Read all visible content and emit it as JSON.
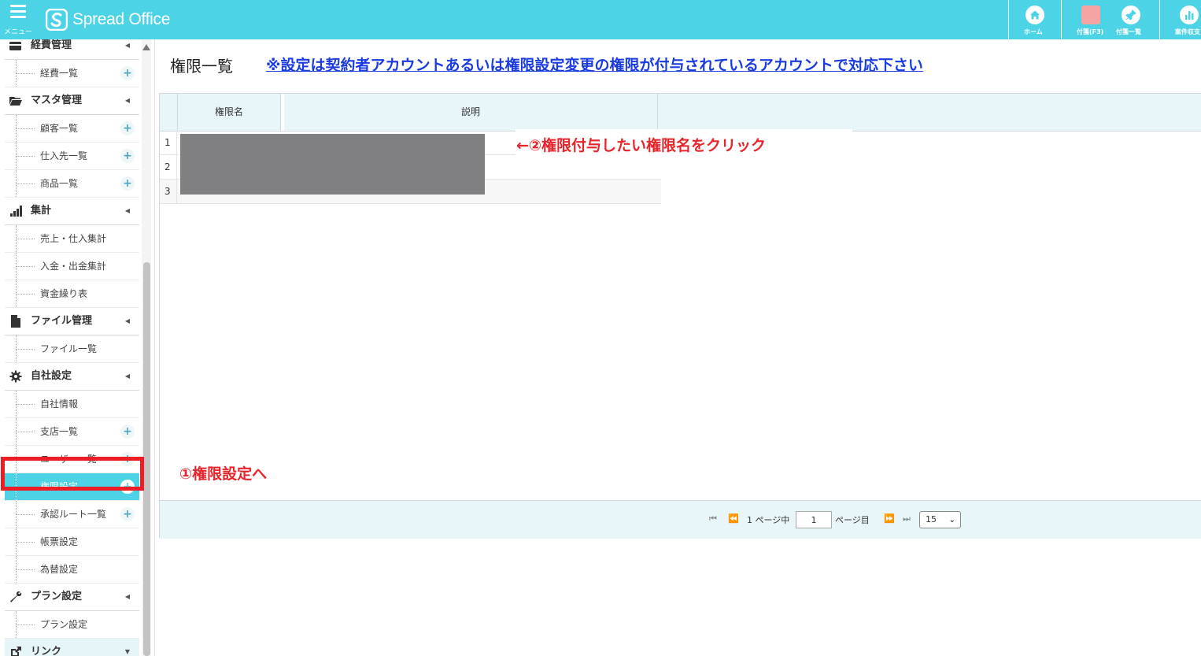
{
  "header": {
    "menu_label": "メニュー",
    "logo_text": "Spread Office",
    "buttons": [
      {
        "label": "ホーム"
      },
      {
        "label": "付箋(F3)"
      },
      {
        "label": "付箋一覧"
      },
      {
        "label": "案件収支"
      }
    ],
    "colors": {
      "bar": "#4dd3e6",
      "sticky_note": "#f5a3a3"
    }
  },
  "sidebar": {
    "sections": [
      {
        "title": "経費管理",
        "icon": "wallet-icon",
        "items": [
          {
            "label": "経費一覧",
            "plus": true
          }
        ]
      },
      {
        "title": "マスタ管理",
        "icon": "folder-open-icon",
        "items": [
          {
            "label": "顧客一覧",
            "plus": true
          },
          {
            "label": "仕入先一覧",
            "plus": true
          },
          {
            "label": "商品一覧",
            "plus": true
          }
        ]
      },
      {
        "title": "集計",
        "icon": "bar-chart-icon",
        "items": [
          {
            "label": "売上・仕入集計",
            "plus": false
          },
          {
            "label": "入金・出金集計",
            "plus": false
          },
          {
            "label": "資金繰り表",
            "plus": false
          }
        ]
      },
      {
        "title": "ファイル管理",
        "icon": "file-icon",
        "items": [
          {
            "label": "ファイル一覧",
            "plus": false
          }
        ]
      },
      {
        "title": "自社設定",
        "icon": "gear-icon",
        "items": [
          {
            "label": "自社情報",
            "plus": false
          },
          {
            "label": "支店一覧",
            "plus": true
          },
          {
            "label": "ユーザー一覧",
            "plus": true
          },
          {
            "label": "権限設定",
            "plus": true,
            "active": true
          },
          {
            "label": "承認ルート一覧",
            "plus": true
          },
          {
            "label": "帳票設定",
            "plus": false
          },
          {
            "label": "為替設定",
            "plus": false
          }
        ]
      },
      {
        "title": "プラン設定",
        "icon": "wrench-icon",
        "items": [
          {
            "label": "プラン設定",
            "plus": false
          }
        ]
      },
      {
        "title": "リンク",
        "icon": "external-link-icon",
        "items": []
      }
    ]
  },
  "main": {
    "title": "権限一覧",
    "notice": "※設定は契約者アカウントあるいは権限設定変更の権限が付与されているアカウントで対応下さい",
    "table": {
      "columns": [
        "権限名",
        "説明"
      ],
      "rows": [
        "1",
        "2",
        "3"
      ]
    },
    "pager": {
      "total_pages_text": "1 ページ中",
      "current_page": "1",
      "page_suffix": "ページ目",
      "page_size": "15"
    }
  },
  "annotations": {
    "step1": "①権限設定へ",
    "step2": "←②権限付与したい権限名をクリック",
    "highlight_color": "#ee1c25"
  }
}
